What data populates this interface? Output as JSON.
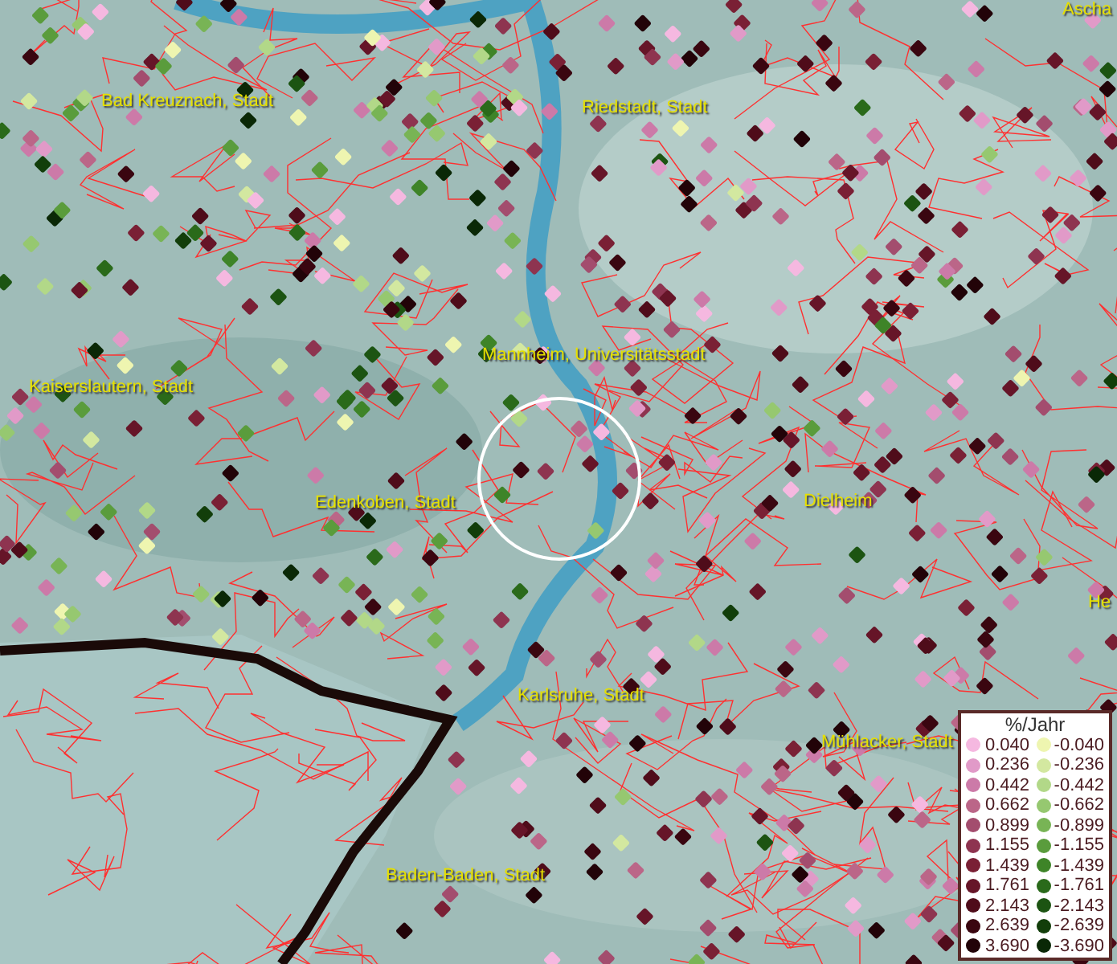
{
  "map": {
    "places": [
      {
        "name": "Bad Kreuznach, Stadt"
      },
      {
        "name": "Riedstadt, Stadt"
      },
      {
        "name": "Ascha"
      },
      {
        "name": "Mannheim, Universitätsstadt"
      },
      {
        "name": "Kaiserslautern, Stadt"
      },
      {
        "name": "Edenkoben, Stadt"
      },
      {
        "name": "Dielheim"
      },
      {
        "name": "He"
      },
      {
        "name": "Karlsruhe, Stadt"
      },
      {
        "name": "Mühlacker, Stadt"
      },
      {
        "name": "Baden-Baden, Stadt"
      }
    ]
  },
  "legend": {
    "title": "%/Jahr",
    "rows": [
      {
        "positive": {
          "label": "0.040",
          "color": "#f5b8e0"
        },
        "negative": {
          "label": "-0.040",
          "color": "#eef5b0"
        }
      },
      {
        "positive": {
          "label": "0.236",
          "color": "#e19ac8"
        },
        "negative": {
          "label": "-0.236",
          "color": "#d3e8a0"
        }
      },
      {
        "positive": {
          "label": "0.442",
          "color": "#cc7aa8"
        },
        "negative": {
          "label": "-0.442",
          "color": "#b2d888"
        }
      },
      {
        "positive": {
          "label": "0.662",
          "color": "#bb6688"
        },
        "negative": {
          "label": "-0.662",
          "color": "#96c870"
        }
      },
      {
        "positive": {
          "label": "0.899",
          "color": "#a34d6e"
        },
        "negative": {
          "label": "-0.899",
          "color": "#78b455"
        }
      },
      {
        "positive": {
          "label": "1.155",
          "color": "#8e3450"
        },
        "negative": {
          "label": "-1.155",
          "color": "#5a9c3c"
        }
      },
      {
        "positive": {
          "label": "1.439",
          "color": "#7a2035"
        },
        "negative": {
          "label": "-1.439",
          "color": "#3e8428"
        }
      },
      {
        "positive": {
          "label": "1.761",
          "color": "#661528"
        },
        "negative": {
          "label": "-1.761",
          "color": "#2a6a1a"
        }
      },
      {
        "positive": {
          "label": "2.143",
          "color": "#4f0c1a"
        },
        "negative": {
          "label": "-2.143",
          "color": "#1c5412"
        }
      },
      {
        "positive": {
          "label": "2.639",
          "color": "#3a0610"
        },
        "negative": {
          "label": "-2.639",
          "color": "#123e0a"
        }
      },
      {
        "positive": {
          "label": "3.690",
          "color": "#220308"
        },
        "negative": {
          "label": "-3.690",
          "color": "#0a2806"
        }
      }
    ]
  }
}
